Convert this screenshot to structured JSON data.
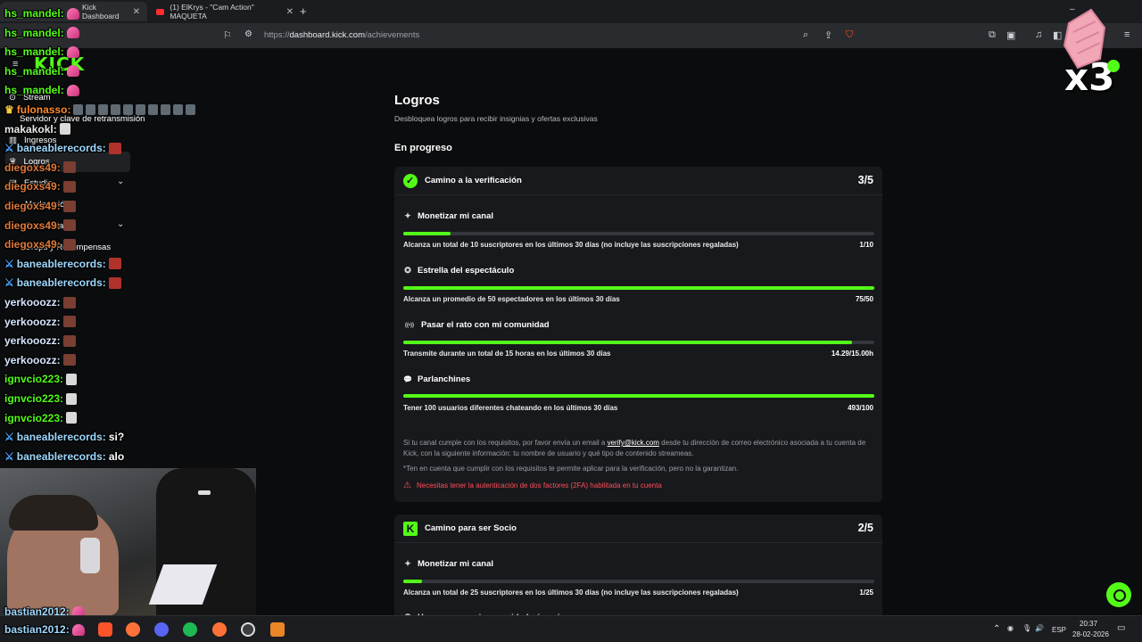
{
  "browser": {
    "tabs": [
      {
        "label": "Kick Dashboard",
        "active": true
      },
      {
        "label": "(1) ElKrys - \"Cam Action\" MAQUETA",
        "active": false
      }
    ],
    "url_host": "dashboard.kick.com",
    "url_path": "/achievements",
    "url_prefix": "https://"
  },
  "sidebar": {
    "logo": "KICK",
    "items": [
      {
        "label": "Stream",
        "icon": "broadcast-icon"
      },
      {
        "label": "Servidor y clave de retransmisión",
        "icon": ""
      },
      {
        "label": "Ingresos",
        "icon": "chart-icon"
      },
      {
        "label": "Logros",
        "icon": "trophy-icon"
      },
      {
        "label": "Estudio",
        "icon": "studio-icon"
      },
      {
        "label": "Moderación",
        "icon": ""
      },
      {
        "label": "Comunidad",
        "icon": ""
      },
      {
        "label": "Drops y Recompensas",
        "icon": ""
      }
    ]
  },
  "chat": [
    {
      "user": "hs_mandel:",
      "color": "#53fc18",
      "msg": "",
      "emote": "heart"
    },
    {
      "user": "hs_mandel:",
      "color": "#53fc18",
      "msg": "",
      "emote": "heart"
    },
    {
      "user": "hs_mandel:",
      "color": "#53fc18",
      "msg": "",
      "emote": "heart"
    },
    {
      "user": "hs_mandel:",
      "color": "#53fc18",
      "msg": "",
      "emote": "heart"
    },
    {
      "user": "hs_mandel:",
      "color": "#53fc18",
      "msg": "",
      "emote": "heart"
    },
    {
      "user": "fulonasso:",
      "color": "#ff8a2b",
      "msg": "",
      "emote": "mini"
    },
    {
      "user": "makakokl:",
      "color": "#e8e8e8",
      "msg": "",
      "emote": "speaker"
    },
    {
      "user": "baneablerecords:",
      "color": "#9fd8ff",
      "msg": "",
      "emote": "devil"
    },
    {
      "user": "diegoxs49:",
      "color": "#e07a3a",
      "msg": "",
      "emote": "face"
    },
    {
      "user": "diegoxs49:",
      "color": "#e07a3a",
      "msg": "",
      "emote": "face"
    },
    {
      "user": "diegoxs49:",
      "color": "#e07a3a",
      "msg": "",
      "emote": "face"
    },
    {
      "user": "diegoxs49:",
      "color": "#e07a3a",
      "msg": "",
      "emote": "face"
    },
    {
      "user": "diegoxs49:",
      "color": "#e07a3a",
      "msg": "",
      "emote": "face"
    },
    {
      "user": "baneablerecords:",
      "color": "#9fd8ff",
      "msg": "",
      "emote": "devil"
    },
    {
      "user": "baneablerecords:",
      "color": "#9fd8ff",
      "msg": "",
      "emote": "devil"
    },
    {
      "user": "yerkooozz:",
      "color": "#d7e6ff",
      "msg": "",
      "emote": "face"
    },
    {
      "user": "yerkooozz:",
      "color": "#d7e6ff",
      "msg": "",
      "emote": "face"
    },
    {
      "user": "yerkooozz:",
      "color": "#d7e6ff",
      "msg": "",
      "emote": "face"
    },
    {
      "user": "yerkooozz:",
      "color": "#d7e6ff",
      "msg": "",
      "emote": "face"
    },
    {
      "user": "ignvcio223:",
      "color": "#53fc18",
      "msg": "",
      "emote": "speaker"
    },
    {
      "user": "ignvcio223:",
      "color": "#53fc18",
      "msg": "",
      "emote": "speaker"
    },
    {
      "user": "ignvcio223:",
      "color": "#53fc18",
      "msg": "",
      "emote": "speaker"
    },
    {
      "user": "baneablerecords:",
      "color": "#9fd8ff",
      "msg": "si?",
      "emote": ""
    },
    {
      "user": "baneablerecords:",
      "color": "#9fd8ff",
      "msg": "alo",
      "emote": ""
    }
  ],
  "chat_bottom": [
    {
      "user": "bastian2012:",
      "color": "#9fd8ff"
    },
    {
      "user": "bastian2012:",
      "color": "#9fd8ff"
    }
  ],
  "page": {
    "title": "Logros",
    "subtitle": "Desbloquea logros para recibir insignias y ofertas exclusivas",
    "section": "En progreso"
  },
  "cards": [
    {
      "title": "Camino a la verificación",
      "count": "3/5",
      "goals": [
        {
          "name": "Monetizar mi canal",
          "icon": "✦",
          "desc": "Alcanza un total de 10 suscriptores en los últimos 30 días (no incluye las suscripciones regaladas)",
          "value": "1/10",
          "progress": 0.1
        },
        {
          "name": "Estrella del espectáculo",
          "icon": "✪",
          "desc": "Alcanza un promedio de 50 espectadores en los últimos 30 días",
          "value": "75/50",
          "progress": 1.0
        },
        {
          "name": "Pasar el rato con mi comunidad",
          "icon": "((•))",
          "desc": "Transmite durante un total de 15 horas en los últimos 30 días",
          "value": "14.29/15.00h",
          "progress": 0.953
        },
        {
          "name": "Parlanchines",
          "icon": "💬",
          "desc": "Tener 100 usuarios diferentes chateando en los últimos 30 días",
          "value": "493/100",
          "progress": 1.0
        }
      ],
      "info_1_a": "Si tu canal cumple con los requisitos, por favor envía un email a",
      "info_email": "verify@kick.com",
      "info_1_b": "desde tu dirección de correo electrónico asociada a tu cuenta de Kick, con la siguiente información: tu nombre de usuario y qué tipo de contenido streameas.",
      "info_2": "*Ten en cuenta que cumplir con los requisitos te permite aplicar para la verificación, pero no la garantizan.",
      "warning": "Necesitas tener la autenticación de dos factores (2FA) habilitada en tu cuenta"
    },
    {
      "title": "Camino para ser Socio",
      "count": "2/5",
      "goals": [
        {
          "name": "Monetizar mi canal",
          "icon": "✦",
          "desc": "Alcanza un total de 25 suscriptores en los últimos 30 días (no incluye las suscripciones regaladas)",
          "value": "1/25",
          "progress": 0.04
        },
        {
          "name": "Hacer crecer mi comunidad aún más",
          "icon": "✪",
          "desc": "",
          "value": "",
          "progress": 0
        }
      ]
    }
  ],
  "overlay": {
    "multiplier": "x3"
  },
  "taskbar": {
    "lang": "ESP",
    "time": "20:37",
    "date": "28-02-2026"
  },
  "colors": {
    "accent": "#53fc18",
    "warning": "#ff4d5a",
    "card": "#18191c",
    "bg": "#0b0c0d"
  }
}
